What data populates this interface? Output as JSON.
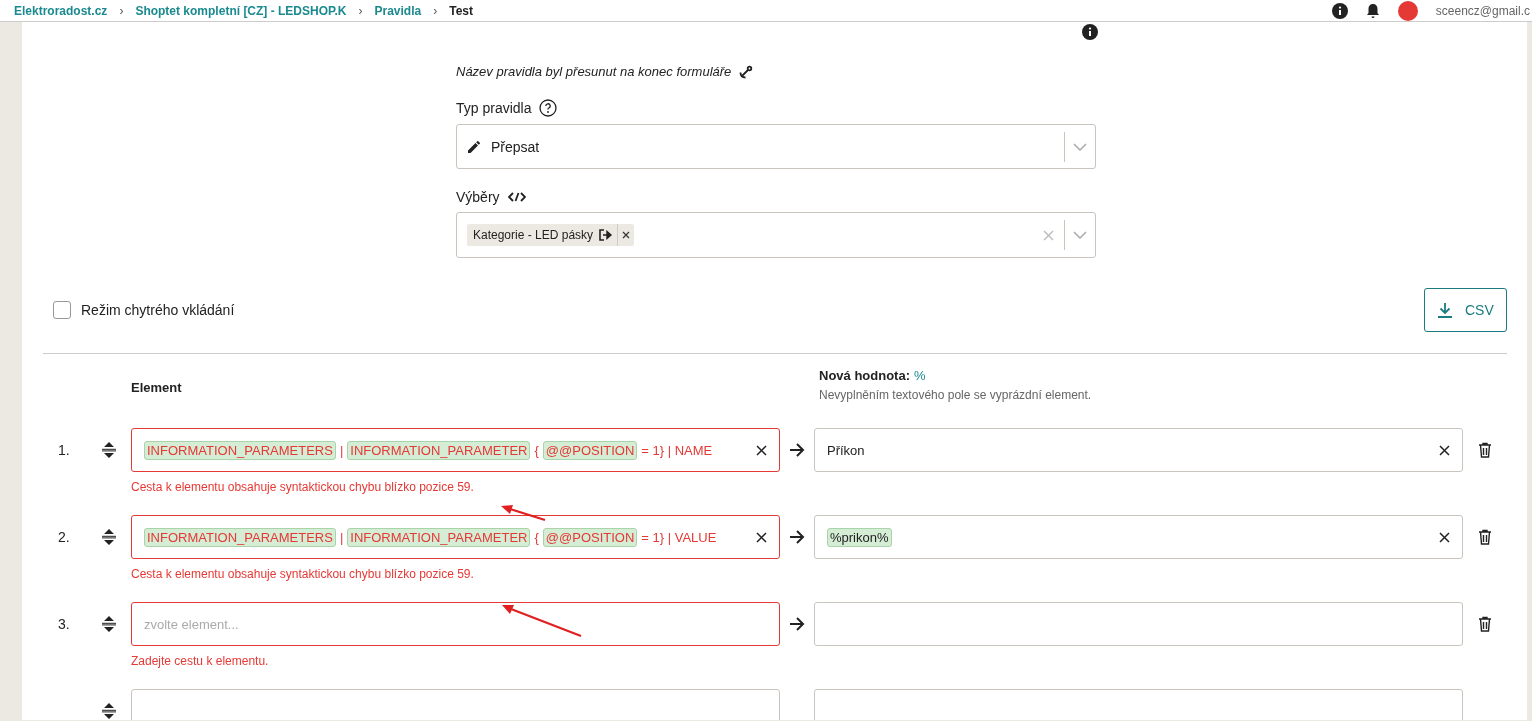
{
  "header": {
    "breadcrumbs": [
      "Elektroradost.cz",
      "Shoptet kompletní [CZ] - LEDSHOP.K",
      "Pravidla",
      "Test"
    ],
    "separator": "›",
    "user_email": "sceencz@gmail.c"
  },
  "form": {
    "note": "Název pravidla byl přesunut na konec formuláře",
    "rule_type": {
      "label": "Typ pravidla",
      "value": "Přepsat"
    },
    "selections": {
      "label": "Výběry",
      "tags": [
        {
          "text": "Kategorie - LED pásky",
          "kind": "category"
        }
      ]
    }
  },
  "smart_insert": {
    "label": "Režim chytrého vkládání",
    "checked": false
  },
  "csv_button": {
    "label": "CSV"
  },
  "columns": {
    "element": "Element",
    "new_value": "Nová hodnota:",
    "new_value_hint": "%",
    "new_value_help": "Nevyplněním textového pole se vyprázdní element."
  },
  "rows": [
    {
      "number": "1.",
      "invalid": true,
      "element": [
        {
          "kind": "tag",
          "text": "INFORMATION_PARAMETERS"
        },
        {
          "kind": "text",
          "text": "|"
        },
        {
          "kind": "tag",
          "text": "INFORMATION_PARAMETER"
        },
        {
          "kind": "text",
          "text": "{"
        },
        {
          "kind": "tag",
          "text": "@@POSITION"
        },
        {
          "kind": "text",
          "text": "= 1} | NAME"
        }
      ],
      "value": [
        {
          "kind": "text",
          "text": "Příkon"
        }
      ],
      "error": "Cesta k elementu obsahuje syntaktickou chybu blízko pozice 59."
    },
    {
      "number": "2.",
      "invalid": true,
      "element": [
        {
          "kind": "tag",
          "text": "INFORMATION_PARAMETERS"
        },
        {
          "kind": "text",
          "text": "|"
        },
        {
          "kind": "tag",
          "text": "INFORMATION_PARAMETER"
        },
        {
          "kind": "text",
          "text": "{"
        },
        {
          "kind": "tag",
          "text": "@@POSITION"
        },
        {
          "kind": "text",
          "text": "= 1} | VALUE"
        }
      ],
      "value": [
        {
          "kind": "tag",
          "text": "%prikon%"
        }
      ],
      "error": "Cesta k elementu obsahuje syntaktickou chybu blízko pozice 59."
    },
    {
      "number": "3.",
      "invalid": true,
      "element_placeholder": "zvolte element...",
      "error": "Zadejte cestu k elementu."
    },
    {
      "invalid": false
    }
  ]
}
